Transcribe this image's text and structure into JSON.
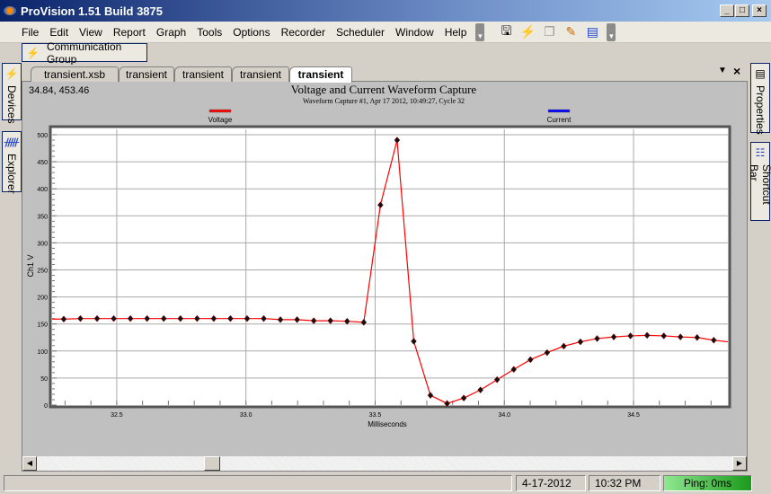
{
  "window": {
    "title": "ProVision 1.51 Build 3875",
    "controls": [
      "_",
      "□",
      "×"
    ]
  },
  "menu": [
    "File",
    "Edit",
    "View",
    "Report",
    "Graph",
    "Tools",
    "Options",
    "Recorder",
    "Scheduler",
    "Window",
    "Help"
  ],
  "toolbar": {
    "icons": [
      "save-report-icon",
      "voltage-meter-icon",
      "copy-icon",
      "pencil-icon",
      "chart-report-icon"
    ]
  },
  "comm_group": {
    "label": "Communication Group"
  },
  "left_tabs": [
    {
      "label": "Devices"
    },
    {
      "label": "Explorer"
    }
  ],
  "right_tabs": [
    {
      "label": "Properties"
    },
    {
      "label": "Shortcut Bar"
    }
  ],
  "doc_tabs": [
    {
      "label": "transient.xsb"
    },
    {
      "label": "transient"
    },
    {
      "label": "transient"
    },
    {
      "label": "transient"
    },
    {
      "label": "transient",
      "active": true
    }
  ],
  "cursor_readout": "34.84, 453.46",
  "chart_data": {
    "type": "line",
    "title": "Voltage and Current Waveform Capture",
    "subtitle": "Waveform Capture #1, Apr 17 2012, 10:49:27, Cycle 32",
    "xlabel": "Milliseconds",
    "ylabel": "Ch1 V",
    "xlim": [
      32.25,
      34.865
    ],
    "ylim": [
      0,
      500
    ],
    "xticks": [
      "32.5",
      "33.0",
      "33.5",
      "34.0",
      "34.5"
    ],
    "yticks": [
      "0",
      "50",
      "100",
      "150",
      "200",
      "250",
      "300",
      "350",
      "400",
      "450",
      "500"
    ],
    "grid": true,
    "legend": [
      {
        "name": "Voltage",
        "color": "#ff0000"
      },
      {
        "name": "Current",
        "color": "#0000ff"
      }
    ],
    "legend_placement": "top",
    "series": [
      {
        "name": "Voltage",
        "color": "#ff0000",
        "x0": 32.295,
        "step": 0.0645,
        "values": [
          159,
          160,
          160,
          160,
          160,
          160,
          160,
          160,
          160,
          160,
          160,
          160,
          160,
          158,
          158,
          156,
          156,
          155,
          153,
          370,
          490,
          118,
          18,
          3,
          13,
          28,
          47,
          66,
          84,
          97,
          109,
          117,
          123,
          126,
          128,
          129,
          128,
          126,
          125,
          120
        ],
        "tail": {
          "x": 34.865,
          "y": 117
        }
      }
    ]
  },
  "status": {
    "date": "4-17-2012",
    "time": "10:32 PM",
    "ping": "Ping: 0ms"
  }
}
